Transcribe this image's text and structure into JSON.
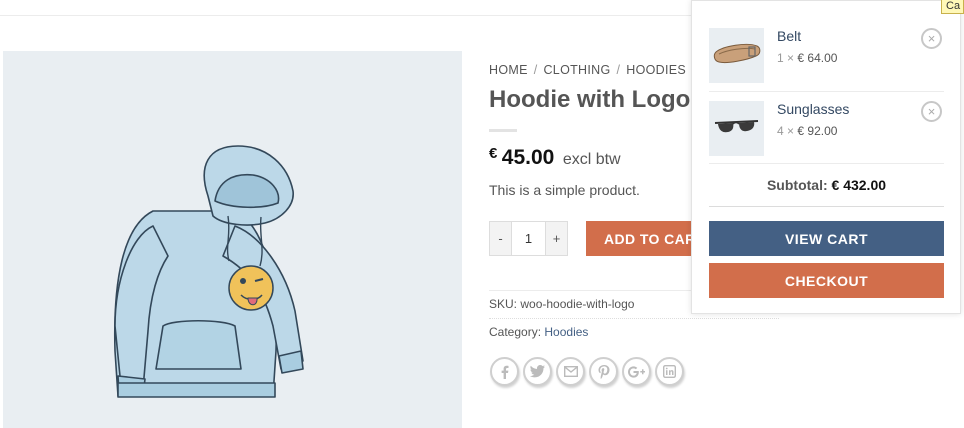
{
  "breadcrumb": {
    "home": "HOME",
    "clothing": "CLOTHING",
    "hoodies": "HOODIES",
    "separator": "/"
  },
  "product": {
    "title": "Hoodie with Logo",
    "price_currency": "€",
    "price_amount": "45.00",
    "price_suffix": "excl btw",
    "short_description": "This is a simple product.",
    "quantity": "1",
    "qty_minus": "-",
    "qty_plus": "+",
    "add_to_cart": "ADD TO CART",
    "sku_label": "SKU:",
    "sku_value": "woo-hoodie-with-logo",
    "category_label": "Category:",
    "category_value": "Hoodies"
  },
  "share_icons": [
    "facebook-icon",
    "twitter-icon",
    "email-icon",
    "pinterest-icon",
    "google-plus-icon",
    "linkedin-icon"
  ],
  "mini_cart": {
    "items": [
      {
        "name": "Belt",
        "quantity": "1",
        "times": "×",
        "price": "€ 64.00",
        "remove": "×"
      },
      {
        "name": "Sunglasses",
        "quantity": "4",
        "times": "×",
        "price": "€ 92.00",
        "remove": "×"
      }
    ],
    "subtotal_label": "Subtotal:",
    "subtotal_value": "€ 432.00",
    "view_cart": "VIEW CART",
    "checkout": "CHECKOUT"
  },
  "tooltip": {
    "text": "Ca"
  },
  "colors": {
    "primary": "#446084",
    "accent": "#d26e4b",
    "link": "#334862",
    "image_bg": "#e9eef2"
  }
}
